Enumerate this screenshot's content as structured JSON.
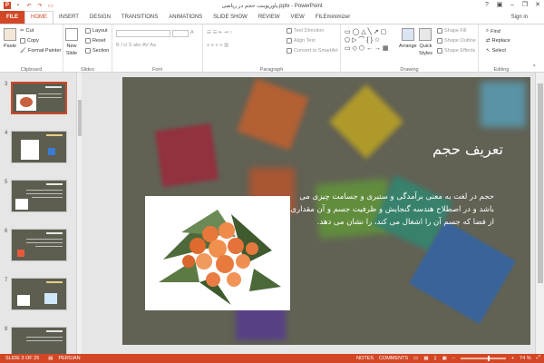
{
  "title": "پاورپوینت حجم در ریاضی.pptx - PowerPoint",
  "signin": "Sign in",
  "tabs": [
    "FILE",
    "HOME",
    "INSERT",
    "DESIGN",
    "TRANSITIONS",
    "ANIMATIONS",
    "SLIDE SHOW",
    "REVIEW",
    "VIEW",
    "FILEminimizer"
  ],
  "ribbon": {
    "clipboard": {
      "label": "Clipboard",
      "paste": "Paste",
      "cut": "Cut",
      "copy": "Copy",
      "format_painter": "Format Painter"
    },
    "slides": {
      "label": "Slides",
      "new_slide_line1": "New",
      "new_slide_line2": "Slide",
      "layout": "Layout",
      "reset": "Reset",
      "section": "Section"
    },
    "font": {
      "label": "Font"
    },
    "paragraph": {
      "label": "Paragraph",
      "text_direction": "Text Direction",
      "align_text": "Align Text",
      "convert_smartart": "Convert to SmartArt"
    },
    "drawing": {
      "label": "Drawing",
      "arrange": "Arrange",
      "quick_styles_1": "Quick",
      "quick_styles_2": "Styles",
      "shape_fill": "Shape Fill",
      "shape_outline": "Shape Outline",
      "shape_effects": "Shape Effects"
    },
    "editing": {
      "label": "Editing",
      "find": "Find",
      "replace": "Replace",
      "select": "Select"
    }
  },
  "thumbnails": [
    "3",
    "4",
    "5",
    "6",
    "7",
    "8"
  ],
  "slide": {
    "title": "تعریف حجم",
    "body": "حجم در لغت به معنی برآمدگی و ستبری و جسامت چیزی می باشد و در اصطلاح هندسه گنجایش و ظرفیت جسم و آن مقداری از فضا که جسم آن را اشغال می کند، را نشان می دهد."
  },
  "status": {
    "slide_of": "SLIDE 3 OF 25",
    "language": "PERSIAN",
    "notes": "NOTES",
    "comments": "COMMENTS",
    "zoom": "74 %"
  },
  "colors": {
    "accent": "#d24726",
    "slide_bg": "#6a6a5c"
  }
}
